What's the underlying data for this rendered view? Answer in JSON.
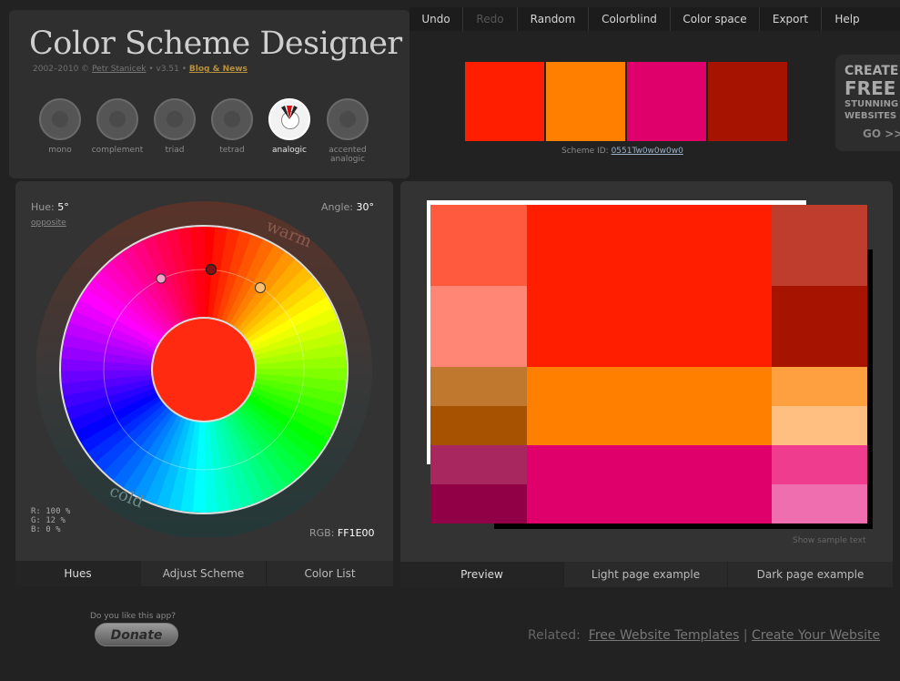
{
  "app": {
    "title": "Color Scheme Designer",
    "copyright": "2002–2010 ©",
    "author": "Petr Stanicek",
    "version": "• v3.51 •",
    "blog": "Blog & News"
  },
  "menu": [
    {
      "label": "Undo",
      "disabled": false
    },
    {
      "label": "Redo",
      "disabled": true
    },
    {
      "label": "Random",
      "disabled": false
    },
    {
      "label": "Colorblind",
      "disabled": false
    },
    {
      "label": "Color space",
      "disabled": false
    },
    {
      "label": "Export",
      "disabled": false
    },
    {
      "label": "Help",
      "disabled": false
    }
  ],
  "schemes": [
    {
      "label": "mono",
      "active": false
    },
    {
      "label": "complement",
      "active": false
    },
    {
      "label": "triad",
      "active": false
    },
    {
      "label": "tetrad",
      "active": false
    },
    {
      "label": "analogic",
      "active": true
    },
    {
      "label": "accented analogic",
      "active": false
    }
  ],
  "swatches": [
    "#FF1E00",
    "#FF7F00",
    "#E0006C",
    "#A61400"
  ],
  "scheme_id": {
    "label": "Scheme ID:",
    "value": "0551Tw0w0w0w0"
  },
  "ad": {
    "line1": "CREATE",
    "line2": "FREE",
    "line3": "STUNNING",
    "line4": "WEBSITES",
    "go": "GO >>"
  },
  "wheel": {
    "hue_label": "Hue:",
    "hue_value": "5°",
    "angle_label": "Angle:",
    "angle_value": "30°",
    "opposite": "opposite",
    "warm": "warm",
    "cold": "cold",
    "r": "R: 100 %",
    "g": "G:  12 %",
    "b": "B:   0 %",
    "rgb_label": "RGB:",
    "rgb_value": "FF1E00",
    "center_color": "#FF2A0F"
  },
  "left_tabs": [
    {
      "label": "Hues",
      "active": true
    },
    {
      "label": "Adjust Scheme",
      "active": false
    },
    {
      "label": "Color List",
      "active": false
    }
  ],
  "right_tabs": [
    {
      "label": "Preview",
      "active": true
    },
    {
      "label": "Light page example",
      "active": false
    },
    {
      "label": "Dark page example",
      "active": false
    }
  ],
  "preview": {
    "show_sample": "Show sample text",
    "rows": [
      {
        "left": [
          "#FF5A3D",
          "#FF8674"
        ],
        "main": "#FF1E00",
        "right": [
          "#BF3D2C",
          "#A61400"
        ]
      },
      {
        "left": [
          "#C0772E",
          "#A65200"
        ],
        "main": "#FF7F00",
        "right": [
          "#FFA040",
          "#FFBF80"
        ]
      },
      {
        "left": [
          "#A8275F",
          "#910046"
        ],
        "main": "#E0006C",
        "right": [
          "#EF3C8F",
          "#EF6EAF"
        ]
      }
    ]
  },
  "donate": {
    "question": "Do you like this app?",
    "button": "Donate"
  },
  "related": {
    "label": "Related:",
    "link1": "Free Website Templates",
    "sep": "|",
    "link2": "Create Your Website"
  }
}
